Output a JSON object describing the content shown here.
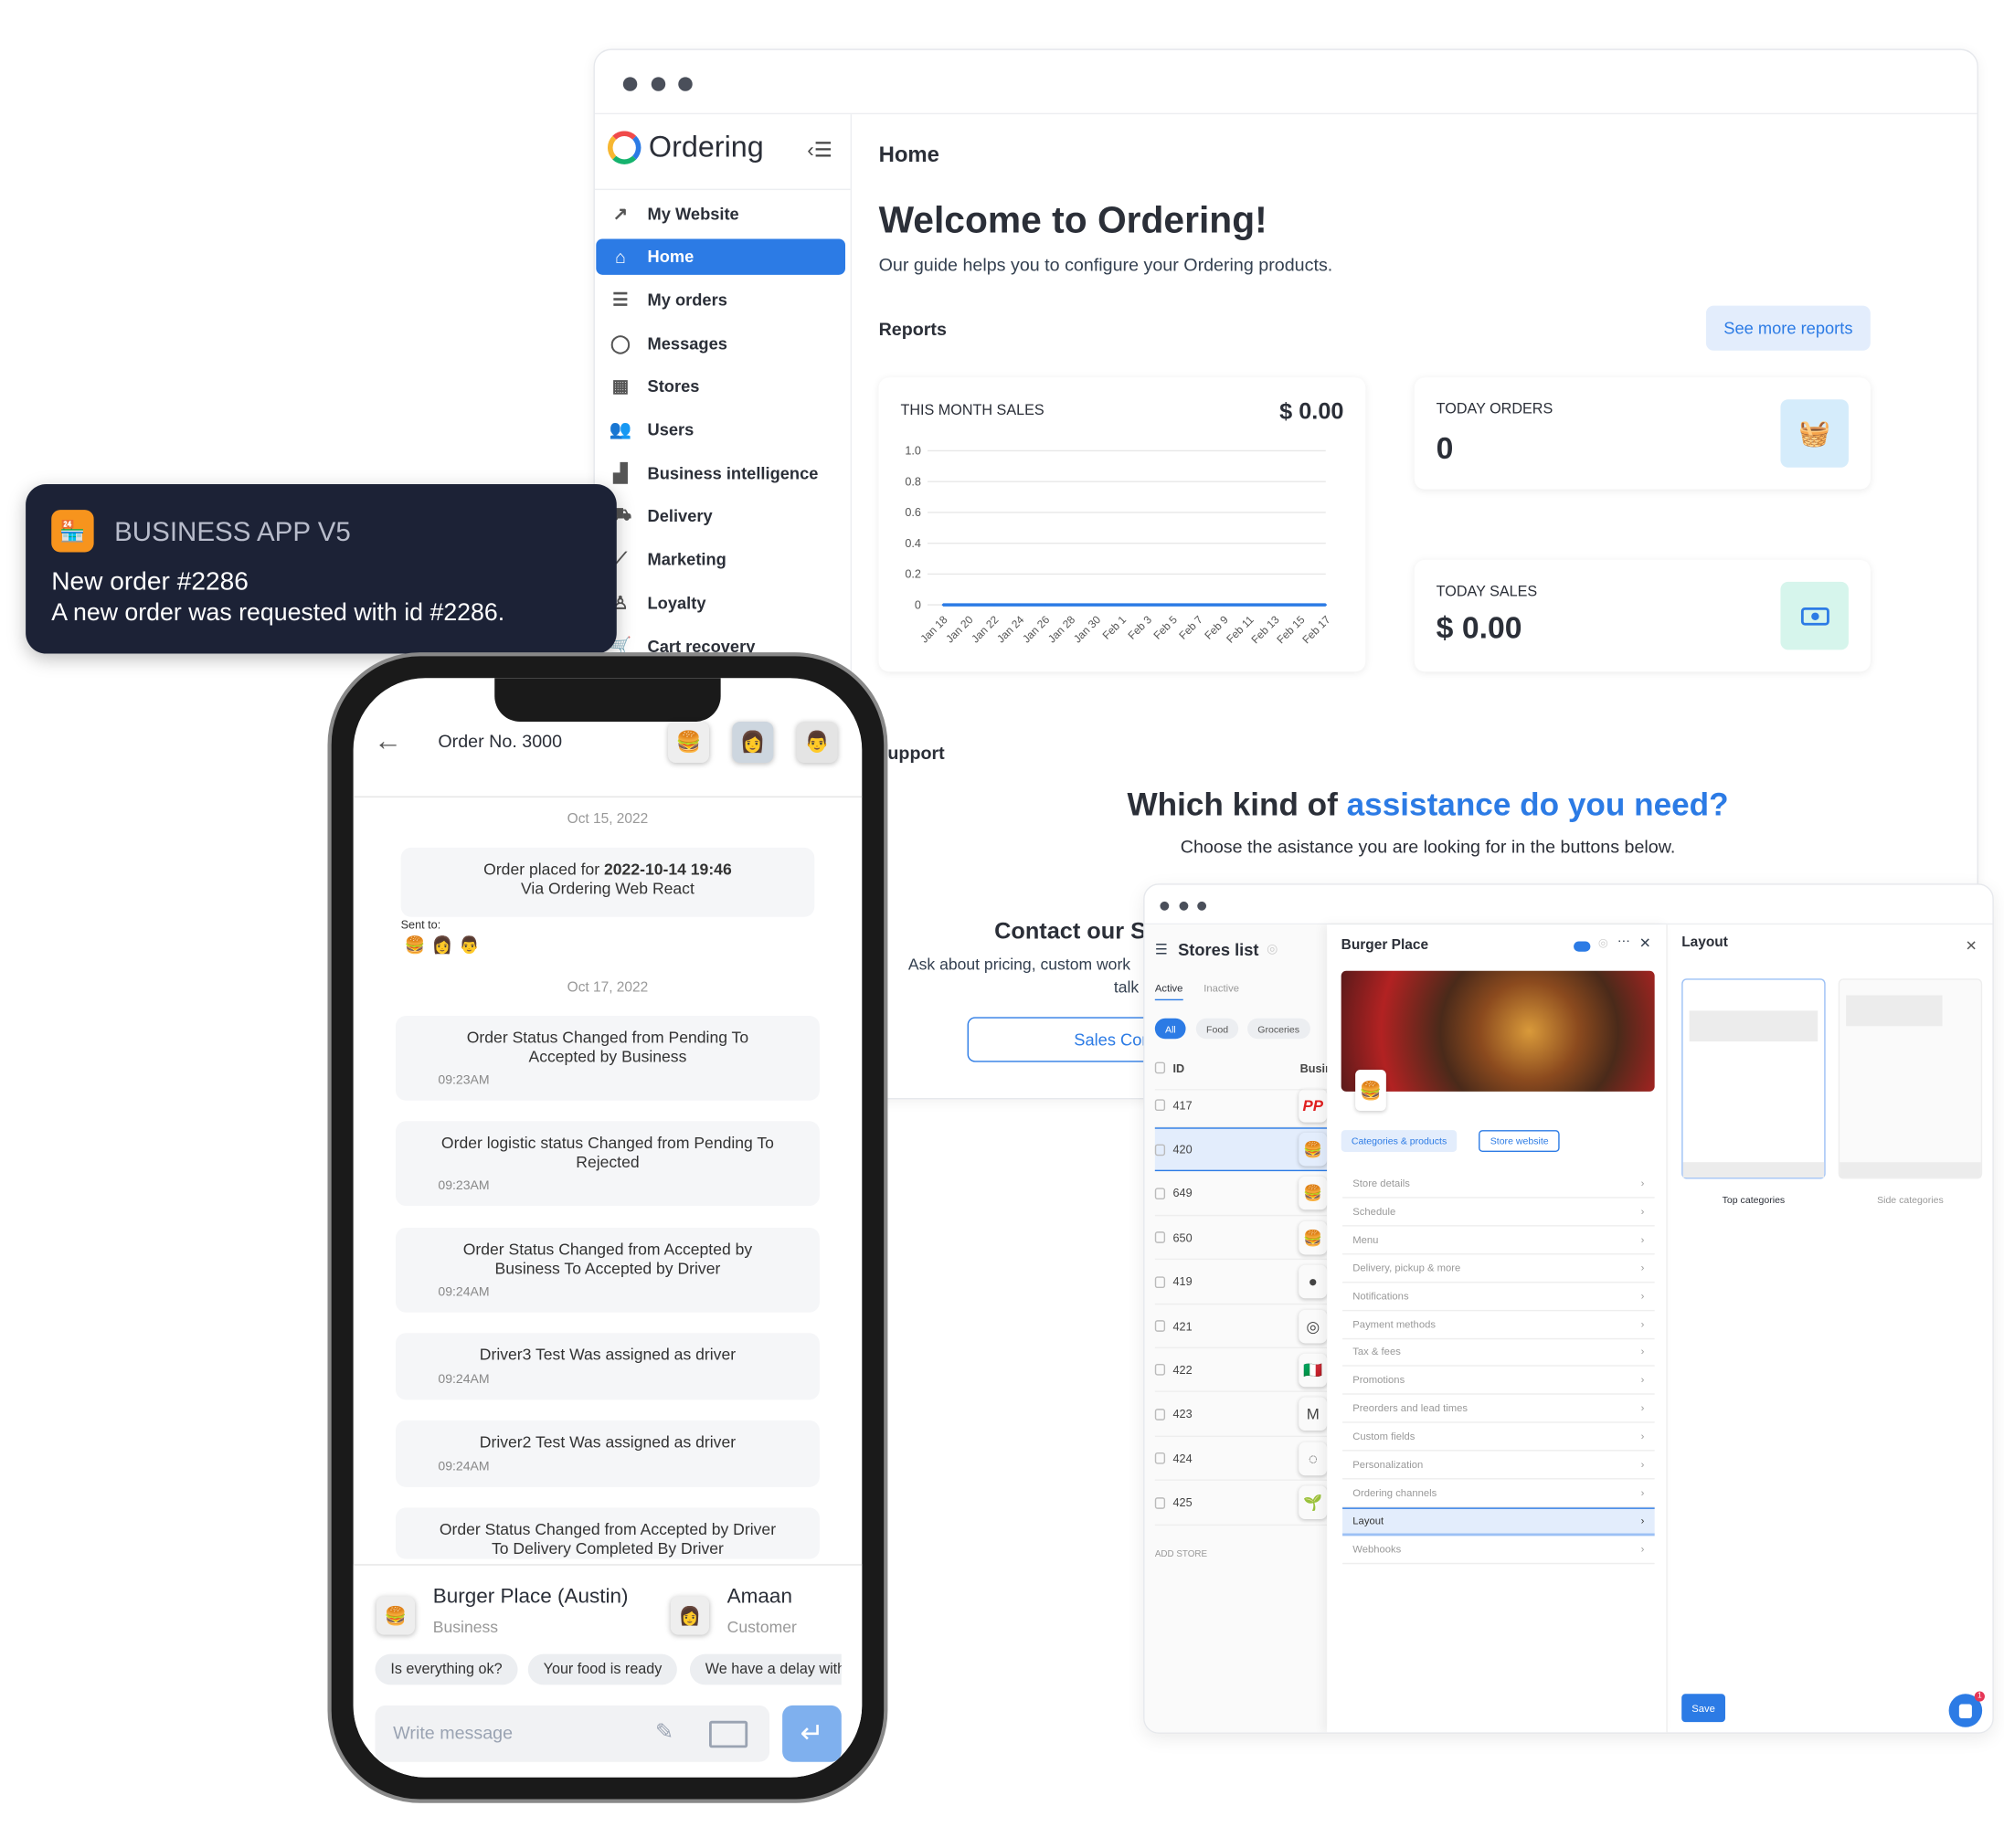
{
  "main_window": {
    "sidebar": {
      "brand": "Ordering",
      "items": [
        {
          "label": "My Website",
          "icon": "external-link-icon"
        },
        {
          "label": "Home",
          "icon": "home-icon",
          "active": true
        },
        {
          "label": "My orders",
          "icon": "list-icon"
        },
        {
          "label": "Messages",
          "icon": "chat-icon"
        },
        {
          "label": "Stores",
          "icon": "store-icon"
        },
        {
          "label": "Users",
          "icon": "users-icon"
        },
        {
          "label": "Business intelligence",
          "icon": "bar-chart-icon"
        },
        {
          "label": "Delivery",
          "icon": "truck-icon"
        },
        {
          "label": "Marketing",
          "icon": "line-chart-icon"
        },
        {
          "label": "Loyalty",
          "icon": "award-icon"
        },
        {
          "label": "Cart recovery",
          "icon": "cart-icon"
        }
      ]
    },
    "header_title": "Home",
    "welcome_title": "Welcome to Ordering!",
    "welcome_subtitle": "Our guide helps you to configure your Ordering products.",
    "reports_label": "Reports",
    "see_more_reports": "See more reports",
    "this_month_sales": {
      "label": "THIS MONTH SALES",
      "value": "$ 0.00"
    },
    "today_orders": {
      "label": "TODAY ORDERS",
      "value": "0",
      "icon": "basket-icon"
    },
    "today_sales": {
      "label": "TODAY SALES",
      "value": "$ 0.00",
      "icon": "cash-icon"
    },
    "support_label": "upport",
    "assistance_title_a": "Which kind of ",
    "assistance_title_b": "assistance do you need?",
    "assistance_subtitle": "Choose the asistance you are looking for in the buttons below.",
    "contact_title": "Contact our S",
    "contact_text_1": "Ask about pricing, custom work",
    "contact_text_2": "talk",
    "sales_button": "Sales Cor",
    "colors": {
      "accent": "#2c7be5",
      "text": "#344050"
    }
  },
  "chart_data": {
    "type": "line",
    "title": "THIS MONTH SALES",
    "categories": [
      "Jan 18",
      "Jan 20",
      "Jan 22",
      "Jan 24",
      "Jan 26",
      "Jan 28",
      "Jan 30",
      "Feb 1",
      "Feb 3",
      "Feb 5",
      "Feb 7",
      "Feb 9",
      "Feb 11",
      "Feb 13",
      "Feb 15",
      "Feb 17"
    ],
    "values": [
      0,
      0,
      0,
      0,
      0,
      0,
      0,
      0,
      0,
      0,
      0,
      0,
      0,
      0,
      0,
      0
    ],
    "yticks": [
      "0",
      "0.2",
      "0.4",
      "0.6",
      "0.8",
      "1.0"
    ],
    "ylim": [
      0,
      1
    ],
    "grid": true,
    "color": "#2c7be5"
  },
  "notification": {
    "app": "BUSINESS APP V5",
    "title": "New order #2286",
    "body": "A new order was requested with id #2286."
  },
  "phone": {
    "order_title": "Order No. 3000",
    "date1": "Oct 15, 2022",
    "placed_prefix": "Order placed for ",
    "placed_date": "2022-10-14 19:46",
    "placed_via": "Via Ordering Web React",
    "sent_to": "Sent to:",
    "date2": "Oct 17, 2022",
    "messages": [
      {
        "text": "Order Status Changed from Pending To Accepted by Business",
        "time": "09:23AM"
      },
      {
        "text": "Order logistic status Changed from Pending To Rejected",
        "time": "09:23AM"
      },
      {
        "text": "Order Status Changed from Accepted by Business To Accepted by Driver",
        "time": "09:24AM"
      },
      {
        "text": "Driver3 Test Was assigned as driver",
        "time": "09:24AM"
      },
      {
        "text": "Driver2 Test Was assigned as driver",
        "time": "09:24AM"
      },
      {
        "text": "Order Status Changed from Accepted by Driver To Delivery Completed By Driver",
        "time": ""
      }
    ],
    "business_name": "Burger Place (Austin)",
    "business_role": "Business",
    "customer_name": "Amaan",
    "customer_role": "Customer",
    "quick_replies": [
      "Is everything ok?",
      "Your food is ready",
      "We have a delay with"
    ],
    "message_placeholder": "Write message"
  },
  "admin_window": {
    "stores_title": "Stores list",
    "tabs": [
      "Active",
      "Inactive"
    ],
    "filters": [
      "All",
      "Food",
      "Groceries"
    ],
    "col_id": "ID",
    "col_business": "Busin",
    "stores": [
      {
        "id": "417",
        "logo": "PP"
      },
      {
        "id": "420",
        "logo": "🍔",
        "selected": true
      },
      {
        "id": "649",
        "logo": "🍔"
      },
      {
        "id": "650",
        "logo": "🍔"
      },
      {
        "id": "419",
        "logo": "●"
      },
      {
        "id": "421",
        "logo": "◎"
      },
      {
        "id": "422",
        "logo": "🇮🇹"
      },
      {
        "id": "423",
        "logo": "M"
      },
      {
        "id": "424",
        "logo": "◌"
      },
      {
        "id": "425",
        "logo": "🌱"
      }
    ],
    "add_store": "ADD STORE",
    "store_name": "Burger Place",
    "btn_categories": "Categories & products",
    "btn_website": "Store website",
    "menu": [
      "Store details",
      "Schedule",
      "Menu",
      "Delivery, pickup & more",
      "Notifications",
      "Payment methods",
      "Tax & fees",
      "Promotions",
      "Preorders and lead times",
      "Custom fields",
      "Personalization",
      "Ordering channels",
      "Layout",
      "Webhooks"
    ],
    "menu_selected": "Layout",
    "layout_title": "Layout",
    "layout_options": [
      "Top categories",
      "Side categories"
    ],
    "save": "Save",
    "chat_badge": "1"
  }
}
